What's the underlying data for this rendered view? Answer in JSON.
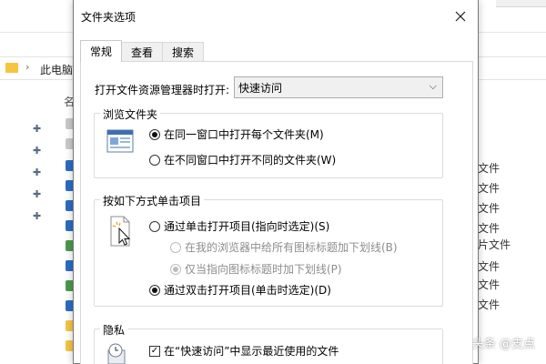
{
  "background": {
    "address_text": "此电脑",
    "column_header": "名",
    "right_labels": [
      "文件",
      "文件",
      "文件",
      "文件",
      "片文件",
      "文件",
      "文件",
      "文件"
    ]
  },
  "dialog": {
    "title": "文件夹选项",
    "tabs": [
      {
        "label": "常规",
        "active": true
      },
      {
        "label": "查看",
        "active": false
      },
      {
        "label": "搜索",
        "active": false
      }
    ],
    "open_explorer_label": "打开文件资源管理器时打开:",
    "open_explorer_value": "快速访问",
    "browse_group": {
      "title": "浏览文件夹",
      "options": [
        {
          "label": "在同一窗口中打开每个文件夹(M)",
          "checked": true
        },
        {
          "label": "在不同窗口中打开不同的文件夹(W)",
          "checked": false
        }
      ]
    },
    "click_group": {
      "title": "按如下方式单击项目",
      "options": [
        {
          "label": "通过单击打开项目(指向时选定)(S)",
          "checked": false,
          "disabled": false
        },
        {
          "label": "在我的浏览器中给所有图标标题加下划线(B)",
          "checked": false,
          "disabled": true
        },
        {
          "label": "仅当指向图标标题时加下划线(P)",
          "checked": true,
          "disabled": true
        },
        {
          "label": "通过双击打开项目(单击时选定)(D)",
          "checked": true,
          "disabled": false
        }
      ]
    },
    "privacy_group": {
      "title": "隐私",
      "checkbox_label": "在“快速访问”中显示最近使用的文件",
      "checked": true
    }
  },
  "watermark": "头条 @支点",
  "colors": {
    "folder_yellow": "#f6c441",
    "file_blue": "#2b6cc4",
    "file_green": "#4a9a4a"
  }
}
